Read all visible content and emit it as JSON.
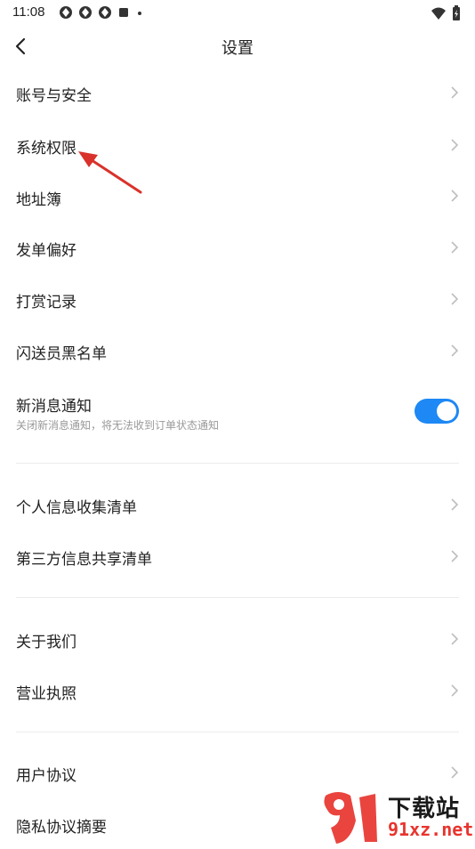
{
  "status_bar": {
    "time": "11:08"
  },
  "header": {
    "title": "设置"
  },
  "settings": {
    "group1": [
      {
        "label": "账号与安全"
      },
      {
        "label": "系统权限"
      },
      {
        "label": "地址簿"
      },
      {
        "label": "发单偏好"
      },
      {
        "label": "打赏记录"
      },
      {
        "label": "闪送员黑名单"
      }
    ],
    "notification": {
      "label": "新消息通知",
      "description": "关闭新消息通知，将无法收到订单状态通知",
      "enabled": true
    },
    "group2": [
      {
        "label": "个人信息收集清单"
      },
      {
        "label": "第三方信息共享清单"
      }
    ],
    "group3": [
      {
        "label": "关于我们"
      },
      {
        "label": "营业执照"
      }
    ],
    "group4": [
      {
        "label": "用户协议"
      },
      {
        "label": "隐私协议摘要"
      }
    ]
  },
  "watermark": {
    "title": "下载站",
    "url": "91xz.net"
  },
  "colors": {
    "toggle_on": "#1e88f5",
    "annotation_arrow": "#d9322b",
    "chevron": "#bdbdbd"
  }
}
